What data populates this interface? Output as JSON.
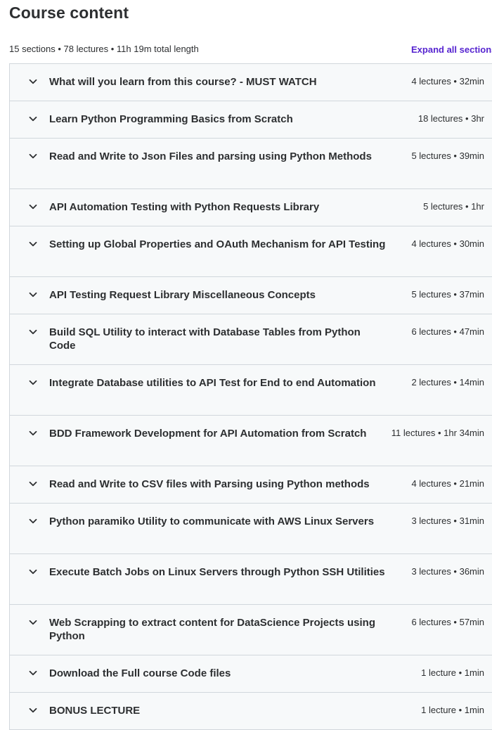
{
  "header": {
    "title": "Course content",
    "summary": "15 sections • 78 lectures • 11h 19m total length",
    "expand_all": "Expand all sections"
  },
  "sections": [
    {
      "title": "What will you learn from this course? - MUST WATCH",
      "meta": "4 lectures • 32min",
      "lines": 1
    },
    {
      "title": "Learn Python Programming Basics from Scratch",
      "meta": "18 lectures • 3hr",
      "lines": 1
    },
    {
      "title": "Read and Write to Json Files and parsing using Python Methods",
      "meta": "5 lectures • 39min",
      "lines": 2
    },
    {
      "title": "API Automation Testing with Python Requests Library",
      "meta": "5 lectures • 1hr",
      "lines": 1
    },
    {
      "title": "Setting up Global Properties and OAuth Mechanism for API Testing",
      "meta": "4 lectures • 30min",
      "lines": 2
    },
    {
      "title": "API Testing Request Library Miscellaneous Concepts",
      "meta": "5 lectures • 37min",
      "lines": 1
    },
    {
      "title": "Build SQL Utility to interact with Database Tables from Python Code",
      "meta": "6 lectures • 47min",
      "lines": 2
    },
    {
      "title": "Integrate Database utilities to API Test for End to end Automation",
      "meta": "2 lectures • 14min",
      "lines": 2
    },
    {
      "title": "BDD Framework Development for API Automation from Scratch",
      "meta": "11 lectures • 1hr 34min",
      "lines": 2
    },
    {
      "title": "Read and Write to CSV files with Parsing using Python methods",
      "meta": "4 lectures • 21min",
      "lines": 1
    },
    {
      "title": "Python paramiko Utility to communicate with AWS Linux Servers",
      "meta": "3 lectures • 31min",
      "lines": 2
    },
    {
      "title": "Execute Batch Jobs on Linux Servers through Python SSH Utilities",
      "meta": "3 lectures • 36min",
      "lines": 2
    },
    {
      "title": "Web Scrapping to extract content for DataScience Projects using Python",
      "meta": "6 lectures • 57min",
      "lines": 2
    },
    {
      "title": "Download the Full course Code files",
      "meta": "1 lecture • 1min",
      "lines": 1
    },
    {
      "title": "BONUS LECTURE",
      "meta": "1 lecture • 1min",
      "lines": 1
    }
  ],
  "icons": {
    "section_toggle": "chevron-down-icon"
  },
  "colors": {
    "accent": "#5624d0",
    "text": "#2d2f31",
    "section_bg": "#f7f9fa",
    "border": "#d1d7dc"
  }
}
